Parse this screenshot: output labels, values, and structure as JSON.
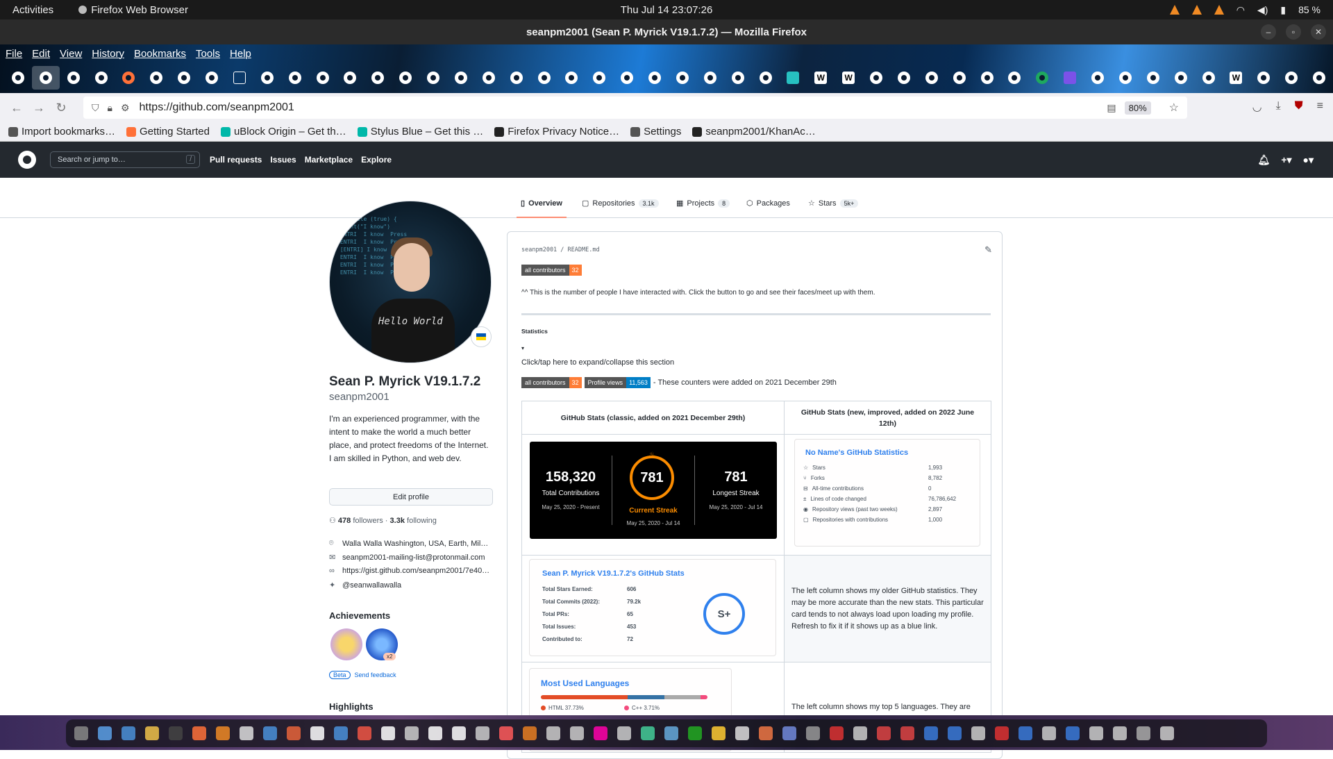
{
  "system": {
    "activities": "Activities",
    "app_name": "Firefox Web Browser",
    "clock": "Thu Jul 14  23:07:26",
    "battery": "85 %"
  },
  "window": {
    "title": "seanpm2001 (Sean P. Myrick V19.1.7.2) — Mozilla Firefox"
  },
  "menu": [
    "File",
    "Edit",
    "View",
    "History",
    "Bookmarks",
    "Tools",
    "Help"
  ],
  "nav": {
    "url": "https://github.com/seanpm2001",
    "zoom": "80%"
  },
  "bookmarks": [
    {
      "label": "Import bookmarks…",
      "color": "#555"
    },
    {
      "label": "Getting Started",
      "color": "#ff7139"
    },
    {
      "label": "uBlock Origin – Get th…",
      "color": "#00b8a9"
    },
    {
      "label": "Stylus Blue – Get this …",
      "color": "#00b8a9"
    },
    {
      "label": "Firefox Privacy Notice…",
      "color": "#222"
    },
    {
      "label": "Settings",
      "color": "#555"
    },
    {
      "label": "seanpm2001/KhanAc…",
      "color": "#222"
    }
  ],
  "github_header": {
    "search_placeholder": "Search or jump to…",
    "slash": "/",
    "nav": [
      "Pull requests",
      "Issues",
      "Marketplace",
      "Explore"
    ]
  },
  "profile_tabs": [
    {
      "label": "Overview",
      "count": ""
    },
    {
      "label": "Repositories",
      "count": "3.1k"
    },
    {
      "label": "Projects",
      "count": "8"
    },
    {
      "label": "Packages",
      "count": ""
    },
    {
      "label": "Stars",
      "count": "5k+"
    }
  ],
  "avatar_text": "Hello World",
  "profile": {
    "name": "Sean P. Myrick V19.1.7.2",
    "login": "seanpm2001",
    "bio": "I'm an experienced programmer, with the intent to make the world a much better place, and protect freedoms of the Internet. I am skilled in Python, and web dev.",
    "edit_label": "Edit profile",
    "followers": "478",
    "followers_label": "followers",
    "following": "3.3k",
    "following_label": "following",
    "location": "Walla Walla Washington, USA, Earth, Mil…",
    "email": "seanpm2001-mailing-list@protonmail.com",
    "website": "https://gist.github.com/seanpm2001/7e40…",
    "twitter": "@seanwallawalla",
    "achievements_title": "Achievements",
    "x2": "x2",
    "beta": "Beta",
    "feedback": "Send feedback",
    "highlights_title": "Highlights"
  },
  "readme": {
    "path_user": "seanpm2001",
    "path_file": "README.md",
    "badge_left": "all contributors",
    "badge_right": "32",
    "people_note": "^^ This is the number of people I have interacted with. Click the button to go and see their faces/meet up with them.",
    "stats_heading": "Statistics",
    "toggle_marker": "▾",
    "toggle_text": "Click/tap here to expand/collapse this section",
    "views_left": "Profile views",
    "views_right": "11,563",
    "counters_note": "- These counters were added on 2021 December 29th",
    "col1_header": "GitHub Stats (classic, added on 2021 December 29th)",
    "col2_header": "GitHub Stats (new, improved, added on 2022 June 12th)"
  },
  "streak": {
    "total": "158,320",
    "total_label": "Total Contributions",
    "total_range": "May 25, 2020 - Present",
    "current": "781",
    "current_label": "Current Streak",
    "current_range": "May 25, 2020 - Jul 14",
    "longest": "781",
    "longest_label": "Longest Streak",
    "longest_range": "May 25, 2020 - Jul 14"
  },
  "new_stats": {
    "title": "No Name's GitHub Statistics",
    "rows": [
      {
        "label": "Stars",
        "value": "1,993"
      },
      {
        "label": "Forks",
        "value": "8,782"
      },
      {
        "label": "All-time contributions",
        "value": "0"
      },
      {
        "label": "Lines of code changed",
        "value": "76,786,642"
      },
      {
        "label": "Repository views (past two weeks)",
        "value": "2,897"
      },
      {
        "label": "Repositories with contributions",
        "value": "1,000"
      }
    ]
  },
  "classic_card": {
    "title": "Sean P. Myrick V19.1.7.2's GitHub Stats",
    "rows": [
      {
        "label": "Total Stars Earned:",
        "value": "606"
      },
      {
        "label": "Total Commits (2022):",
        "value": "79.2k"
      },
      {
        "label": "Total PRs:",
        "value": "65"
      },
      {
        "label": "Total Issues:",
        "value": "453"
      },
      {
        "label": "Contributed to:",
        "value": "72"
      }
    ],
    "grade": "S+"
  },
  "note1": "The left column shows my older GitHub statistics. They may be more accurate than the new stats. This particular card tends to not always load upon loading my profile. Refresh to fix it if it shows up as a blue link.",
  "languages": {
    "title": "Most Used Languages",
    "items": [
      {
        "label": "HTML 37.73%",
        "color": "#e34c26",
        "percent": 37.73
      },
      {
        "label": "C++ 3.71%",
        "color": "#f34b7d",
        "percent": 3.71
      }
    ]
  },
  "note2": "The left column shows my top 5 languages. They are"
}
